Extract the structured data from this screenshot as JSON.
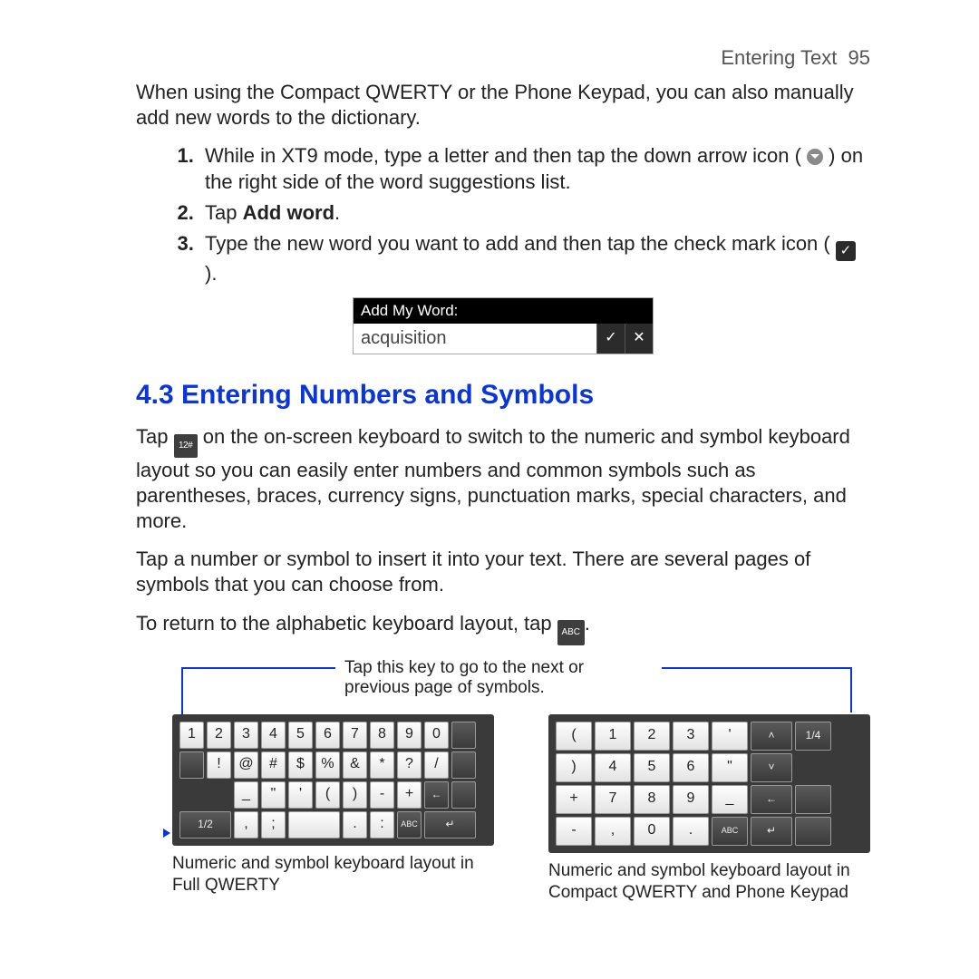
{
  "header": {
    "section": "Entering Text",
    "page": "95"
  },
  "intro": "When using the Compact QWERTY or the Phone Keypad, you can also manually add new words to the dictionary.",
  "steps": {
    "s1a": "While in XT9 mode, type a letter and then tap the down arrow icon (",
    "s1b": ") on the right side of the word suggestions list.",
    "s2a": "Tap ",
    "s2b": "Add word",
    "s2c": ".",
    "s3a": "Type the new word you want to add and then tap the check mark icon (",
    "s3b": ")."
  },
  "addword": {
    "title": "Add My Word:",
    "value": "acquisition"
  },
  "heading": "4.3  Entering Numbers and Symbols",
  "p1a": "Tap ",
  "p1b": " on the on-screen keyboard to switch to the numeric and symbol keyboard layout so you can easily enter numbers and common symbols such as parentheses, braces, currency signs, punctuation marks, special characters, and more.",
  "p2": "Tap a number or symbol to insert it into your text. There are several pages of symbols that you can choose from.",
  "p3a": "To return to the alphabetic keyboard layout, tap ",
  "p3b": ".",
  "callout": "Tap this key to go to the next or previous page of symbols.",
  "kb_full": {
    "r1": [
      "1",
      "2",
      "3",
      "4",
      "5",
      "6",
      "7",
      "8",
      "9",
      "0"
    ],
    "r2": [
      "!",
      "@",
      "#",
      "$",
      "%",
      "&",
      "*",
      "?",
      "/"
    ],
    "r3": [
      "_",
      "\"",
      "'",
      "(",
      ")",
      "-",
      "+",
      "←"
    ],
    "r4_page": "1/2",
    "r4": [
      ",",
      ";",
      " ",
      ".",
      ":"
    ],
    "abc": "ABC"
  },
  "kb_compact": {
    "rows": [
      [
        "(",
        "1",
        "2",
        "3",
        "'"
      ],
      [
        ")",
        "4",
        "5",
        "6",
        "\""
      ],
      [
        "+",
        "7",
        "8",
        "9",
        "_"
      ],
      [
        "-",
        ",",
        "0",
        "."
      ]
    ],
    "page": "1/4",
    "abc": "ABC"
  },
  "caption_full": "Numeric and symbol keyboard layout in Full QWERTY",
  "caption_compact": "Numeric and symbol keyboard layout in Compact QWERTY and Phone Keypad",
  "icon_labels": {
    "num": "12#",
    "abc": "ABC"
  }
}
